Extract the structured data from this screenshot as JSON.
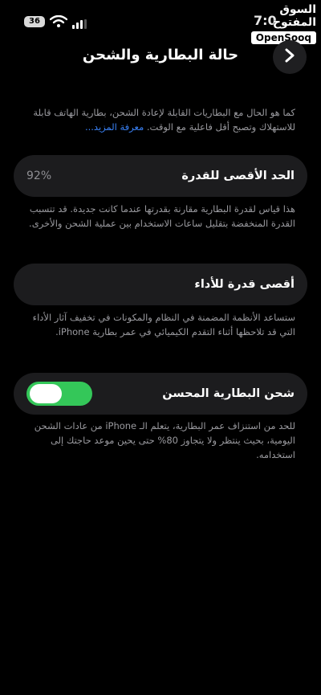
{
  "status_bar": {
    "battery_level": "36",
    "time_partial": "7:0"
  },
  "watermark": {
    "arabic": "السوق المفتوح",
    "english": "OpenSooq"
  },
  "nav": {
    "title": "حالة البطارية والشحن"
  },
  "intro": {
    "text": "كما هو الحال مع البطاريات القابلة لإعادة الشحن، بطارية الهاتف قابلة للاستهلاك وتصبح أقل فاعلية مع الوقت.",
    "link": "معرفة المزيد..."
  },
  "max_capacity": {
    "label": "الحد الأقصى للقدرة",
    "value": "92%",
    "description": "هذا قياس لقدرة البطارية مقارنة بقدرتها عندما كانت جديدة. قد تتسبب القدرة المنخفضة بتقليل ساعات الاستخدام بين عملية الشحن والأخرى."
  },
  "peak_performance": {
    "label": "أقصى قدرة للأداء",
    "description": "ستساعد الأنظمة المضمنة في النظام والمكونات في تخفيف آثار الأداء التي قد تلاحظها أثناء التقدم الكيميائي في عمر بطارية iPhone."
  },
  "optimized_charging": {
    "label": "شحن البطارية المحسن",
    "enabled": true,
    "description": "للحد من استنزاف عمر البطارية، يتعلم الـ iPhone من عادات الشحن اليومية، بحيث ينتظر ولا يتجاوز 80% حتى يحين موعد حاجتك إلى استخدامه."
  },
  "colors": {
    "background": "#000000",
    "card": "#1c1c1e",
    "accent_green": "#34c759",
    "link_blue": "#3a82f7",
    "secondary_text": "#9a9a9f"
  }
}
